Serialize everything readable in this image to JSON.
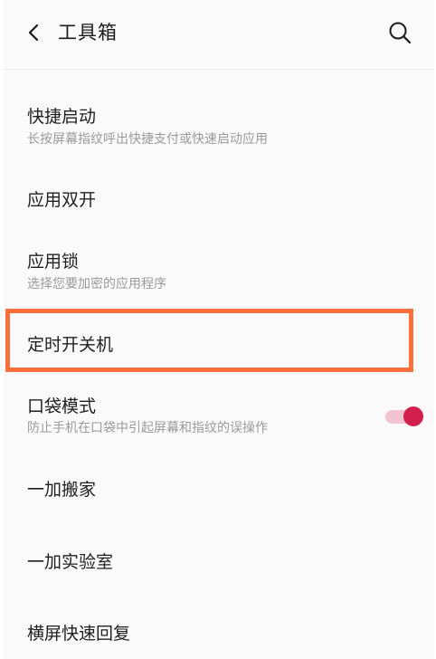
{
  "header": {
    "title": "工具箱",
    "back_icon": "chevron-left-icon",
    "search_icon": "search-icon"
  },
  "items": [
    {
      "label": "快捷启动",
      "subtitle": "长按屏幕指纹呼出快捷支付或快速启动应用"
    },
    {
      "label": "应用双开",
      "subtitle": ""
    },
    {
      "label": "应用锁",
      "subtitle": "选择您要加密的应用程序"
    },
    {
      "label": "定时开关机",
      "subtitle": ""
    },
    {
      "label": "口袋模式",
      "subtitle": "防止手机在口袋中引起屏幕和指纹的误操作",
      "toggle_on": true
    },
    {
      "label": "一加搬家",
      "subtitle": ""
    },
    {
      "label": "一加实验室",
      "subtitle": ""
    },
    {
      "label": "横屏快速回复",
      "subtitle": ""
    }
  ],
  "colors": {
    "highlight": "#ff6f3c",
    "toggle_on": "#d21f4b"
  }
}
